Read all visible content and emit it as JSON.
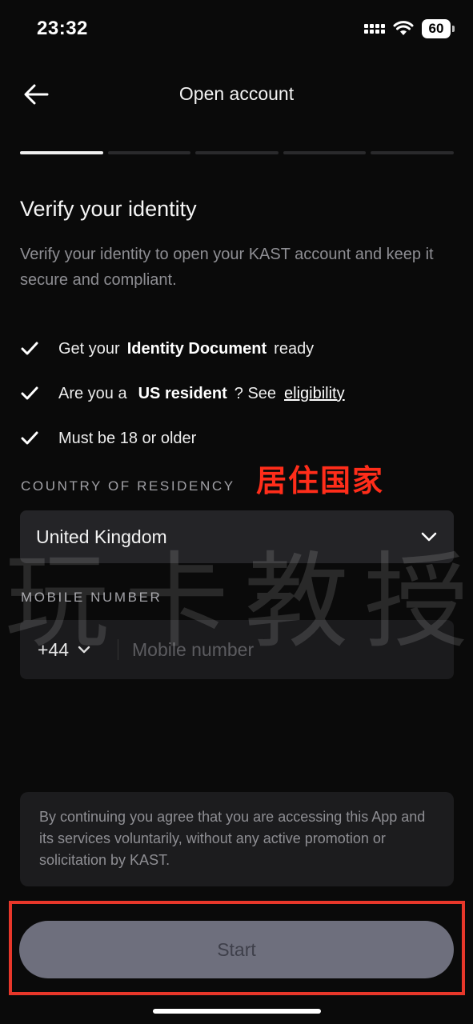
{
  "status_bar": {
    "time": "23:32",
    "battery": "60"
  },
  "header": {
    "title": "Open account",
    "back_icon": "arrow-left-icon"
  },
  "progress": {
    "total_steps": 5,
    "current_step": 1
  },
  "verify": {
    "title": "Verify your identity",
    "description": "Verify your identity to open your KAST account and keep it secure and compliant.",
    "checklist": [
      {
        "pre": "Get your",
        "bold": "Identity Document",
        "post": "ready"
      },
      {
        "pre": "Are you a",
        "bold": "US resident",
        "post": "? See",
        "link": "eligibility"
      },
      {
        "pre": "Must be 18 or older"
      }
    ]
  },
  "country": {
    "label": "COUNTRY OF RESIDENCY",
    "value": "United Kingdom",
    "annotation": "居住国家"
  },
  "mobile": {
    "label": "MOBILE NUMBER",
    "country_code": "+44",
    "placeholder": "Mobile number",
    "value": ""
  },
  "watermark": {
    "chars": [
      "玩",
      "卡",
      "教",
      "授"
    ]
  },
  "disclaimer": "By continuing you agree that you are accessing this App and its services voluntarily, without any active promotion or solicitation by KAST.",
  "start_button": {
    "label": "Start"
  },
  "colors": {
    "background": "#0a0a0a",
    "button_bg": "#6e6f7d",
    "annotation_red": "#ff2d1a",
    "frame_red": "#e8372a"
  }
}
